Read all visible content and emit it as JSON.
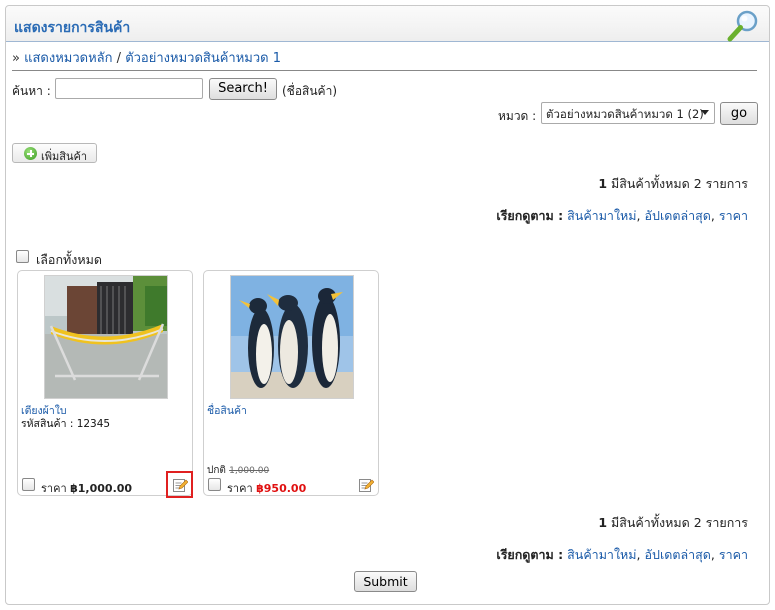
{
  "header": {
    "title": "แสดงรายการสินค้า",
    "magnifier_icon": "magnifier-icon"
  },
  "breadcrumb": {
    "prefix": "»",
    "root": "แสดงหมวดหลัก",
    "separator": "/",
    "current": "ตัวอย่างหมวดสินค้าหมวด 1"
  },
  "search": {
    "label": "ค้นหา :",
    "value": "",
    "placeholder": "",
    "button": "Search!",
    "hint": "(ชื่อสินค้า)"
  },
  "category": {
    "label": "หมวด :",
    "selected": "ตัวอย่างหมวดสินค้าหมวด 1 (2)",
    "go": "go"
  },
  "add_button": "เพิ่มสินค้า",
  "summary": {
    "page": "1",
    "text": "มีสินค้าทั้งหมด 2 รายการ"
  },
  "sort": {
    "label": "เรียกดูตาม :",
    "new": "สินค้ามาใหม่",
    "updated": "อัปเดตล่าสุด",
    "price": "ราคา",
    "sep": ","
  },
  "select_all": "เลือกทั้งหมด",
  "products": [
    {
      "name": "เตียงผ้าใบ",
      "code": "รหัสสินค้า : 12345",
      "normal_label": "",
      "normal_price": "",
      "price_label": "ราคา",
      "price": "฿1,000.00"
    },
    {
      "name": "ชื่อสินค้า",
      "code": "",
      "normal_label": "ปกติ",
      "normal_price": "1,000.00",
      "price_label": "ราคา",
      "price": "฿950.00"
    }
  ],
  "submit": "Submit",
  "colors": {
    "accent": "#2a6bb5",
    "link": "#1a5aa8",
    "sale": "#e01010",
    "highlight_border": "#e02020"
  }
}
